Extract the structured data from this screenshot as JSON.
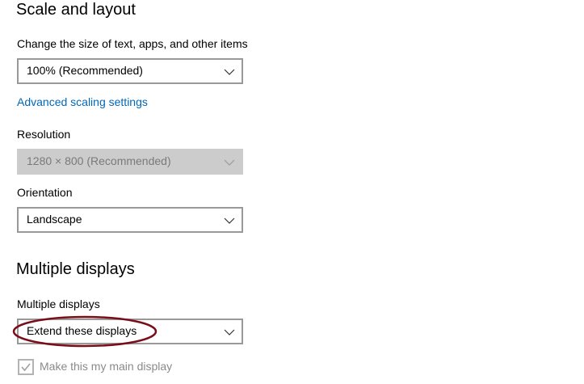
{
  "scale_layout": {
    "title": "Scale and layout",
    "size_label": "Change the size of text, apps, and other items",
    "size_value": "100% (Recommended)",
    "advanced_link": "Advanced scaling settings",
    "resolution_label": "Resolution",
    "resolution_value": "1280 × 800 (Recommended)",
    "orientation_label": "Orientation",
    "orientation_value": "Landscape"
  },
  "multiple_displays": {
    "title": "Multiple displays",
    "label": "Multiple displays",
    "value": "Extend these displays",
    "main_display_checkbox": {
      "label": "Make this my main display",
      "checked": true,
      "disabled": true
    }
  },
  "colors": {
    "accent": "#0067b8",
    "annotation": "#7a0e18",
    "disabled_fill": "#cccccc"
  },
  "icons": {
    "dropdown": "chevron-down-icon",
    "checkbox": "checkmark-icon"
  }
}
